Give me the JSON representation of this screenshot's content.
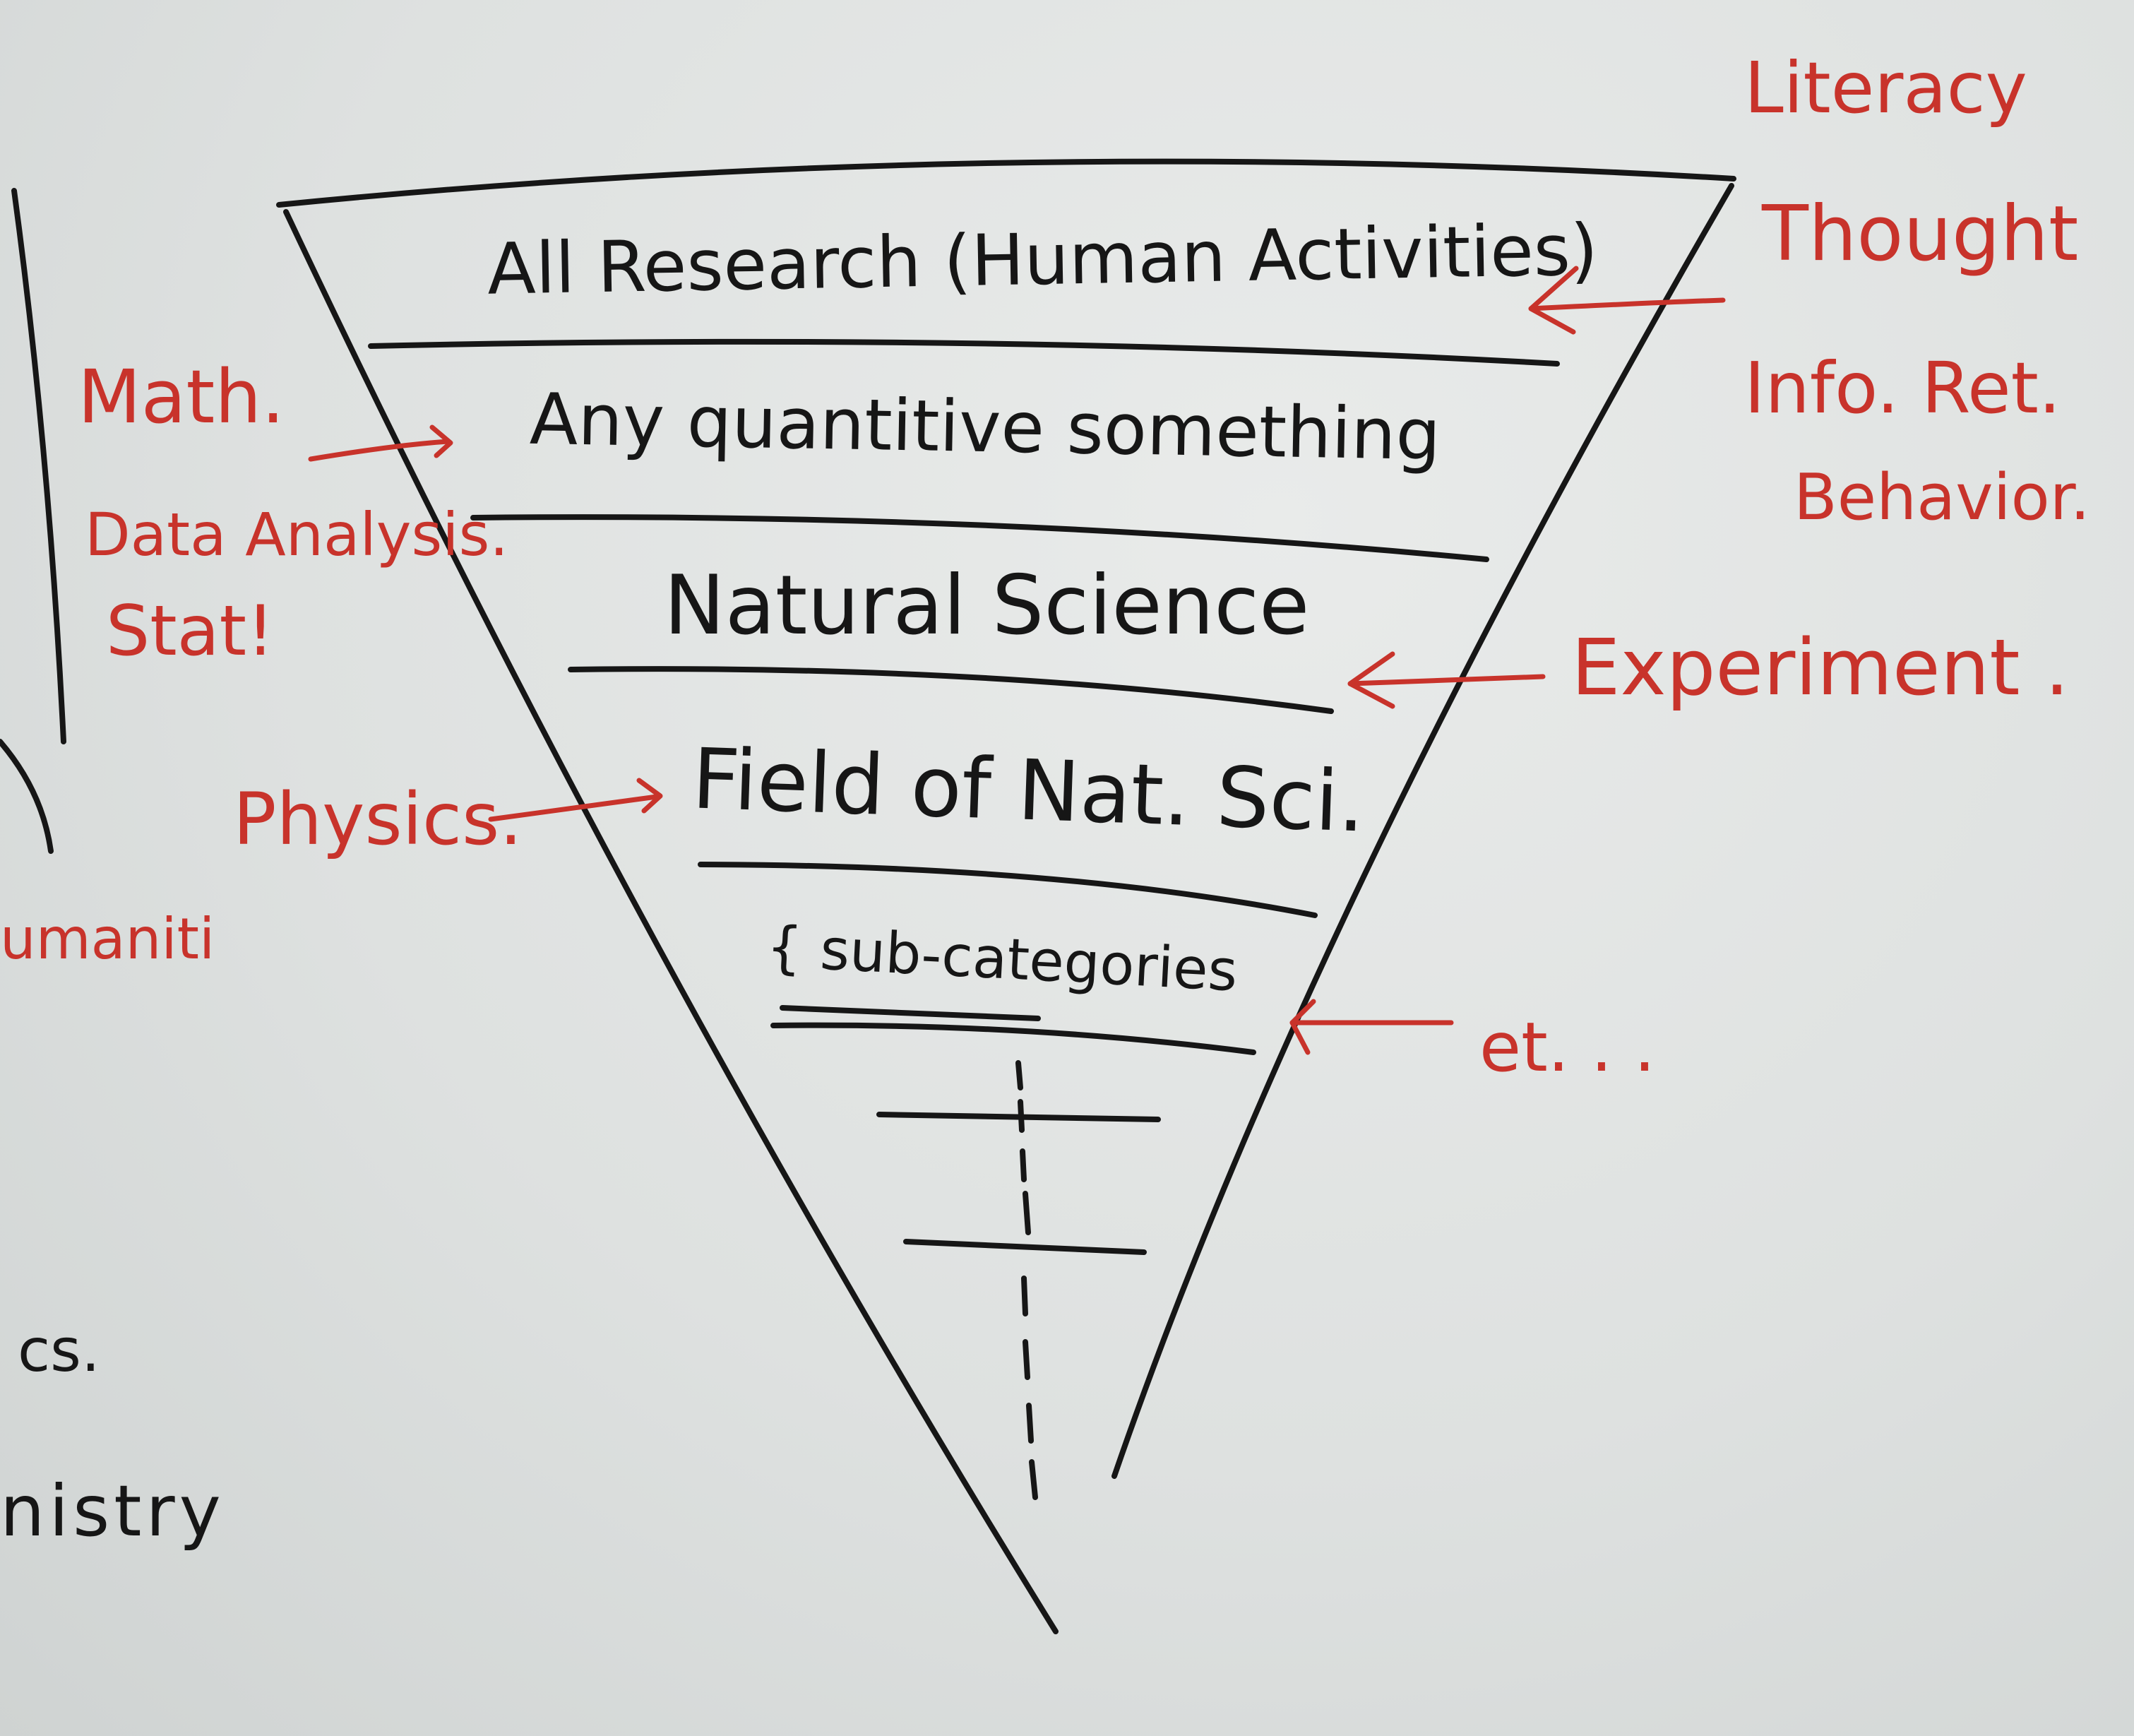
{
  "colors": {
    "board": "#e3e5e4",
    "black_marker": "#161616",
    "red_marker": "#c8332b"
  },
  "funnel": {
    "levels": [
      {
        "label": "All Research (Human Activities)"
      },
      {
        "label": "Any quantitive something"
      },
      {
        "label": "Natural Science"
      },
      {
        "label": "Field of Nat. Sci."
      },
      {
        "label": "{ sub-categories"
      }
    ]
  },
  "annotations_right": {
    "top_group": [
      "Literacy",
      "Thought",
      "Info. Ret.",
      "Behavior."
    ],
    "experiment": "Experiment .",
    "etc": "et. . ."
  },
  "annotations_left": {
    "math_group": [
      "Math.",
      "Data Analysis.",
      "Stat!"
    ],
    "physics": "Physics.",
    "humanities": "umaniti",
    "cs": "cs.",
    "chemistry": "nistry"
  }
}
